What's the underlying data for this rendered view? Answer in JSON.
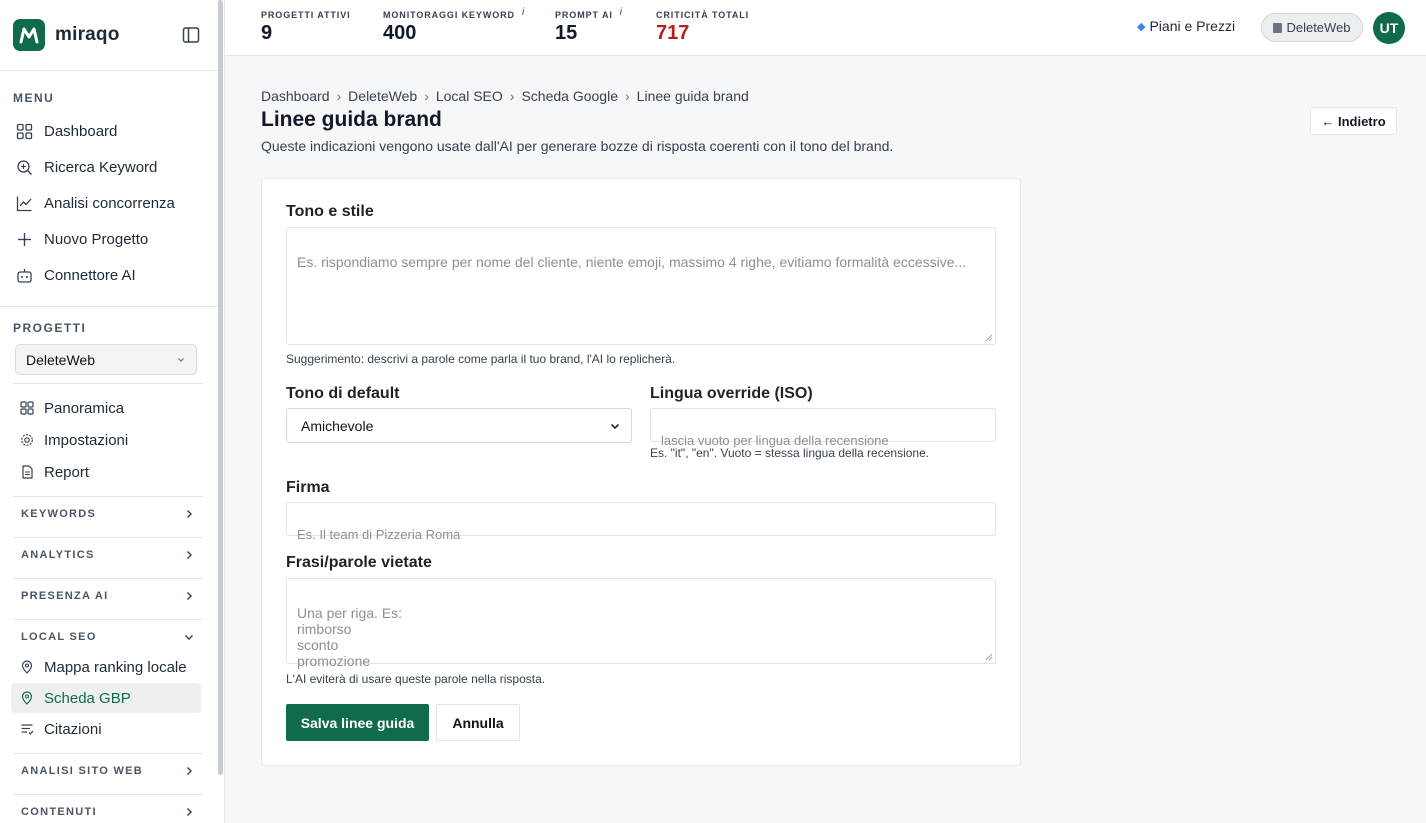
{
  "sidebar": {
    "brand": "miraqo",
    "menu_title": "MENU",
    "menu": [
      {
        "label": "Dashboard",
        "icon": "grid-icon"
      },
      {
        "label": "Ricerca Keyword",
        "icon": "search-icon"
      },
      {
        "label": "Analisi concorrenza",
        "icon": "chart-line-icon"
      },
      {
        "label": "Nuovo Progetto",
        "icon": "plus-icon"
      },
      {
        "label": "Connettore AI",
        "icon": "robot-icon"
      }
    ],
    "projects_title": "PROGETTI",
    "project_selected": "DeleteWeb",
    "project_nav": [
      {
        "label": "Panoramica",
        "icon": "grid-icon"
      },
      {
        "label": "Impostazioni",
        "icon": "gear-icon"
      },
      {
        "label": "Report",
        "icon": "document-icon"
      }
    ],
    "groups": {
      "keywords": "KEYWORDS",
      "analytics": "ANALYTICS",
      "presenza_ai": "PRESENZA AI",
      "local_seo": "LOCAL SEO",
      "analisi_sito": "ANALISI SITO WEB",
      "contenuti": "CONTENUTI"
    },
    "local_seo_items": [
      {
        "label": "Mappa ranking locale",
        "icon": "map-pin-icon"
      },
      {
        "label": "Scheda GBP",
        "icon": "map-pin-icon",
        "active": true
      },
      {
        "label": "Citazioni",
        "icon": "list-icon"
      }
    ]
  },
  "topbar": {
    "stats": [
      {
        "label": "PROGETTI ATTIVI",
        "value": "9",
        "info": false
      },
      {
        "label": "MONITORAGGI KEYWORD",
        "value": "400",
        "info": true
      },
      {
        "label": "PROMPT AI",
        "value": "15",
        "info": true
      },
      {
        "label": "CRITICITÀ TOTALI",
        "value": "717",
        "info": false,
        "color": "#b91c1c"
      }
    ],
    "info_mark": "i",
    "plans_label": "Piani e Prezzi",
    "project_pill": "DeleteWeb",
    "avatar_initials": "UT"
  },
  "breadcrumb": [
    "Dashboard",
    "DeleteWeb",
    "Local SEO",
    "Scheda Google",
    "Linee guida brand"
  ],
  "breadcrumb_sep": "›",
  "page": {
    "title": "Linee guida brand",
    "subtitle": "Queste indicazioni vengono usate dall'AI per generare bozze di risposta coerenti con il tono del brand.",
    "back_label": "← Indietro"
  },
  "form": {
    "tone_style_label": "Tono e stile",
    "tone_style_placeholder": "Es. rispondiamo sempre per nome del cliente, niente emoji, massimo 4 righe, evitiamo formalità eccessive...",
    "tone_style_hint": "Suggerimento: descrivi a parole come parla il tuo brand, l'AI lo replicherà.",
    "default_tone_label": "Tono di default",
    "default_tone_value": "Amichevole",
    "lang_label": "Lingua override (ISO)",
    "lang_placeholder": "lascia vuoto per lingua della recensione",
    "lang_hint": "Es. \"it\", \"en\". Vuoto = stessa lingua della recensione.",
    "signature_label": "Firma",
    "signature_placeholder": "Es. Il team di Pizzeria Roma",
    "banned_label": "Frasi/parole vietate",
    "banned_placeholder": "Una per riga. Es:\nrimborso\nsconto\npromozione",
    "banned_hint": "L'AI eviterà di usare queste parole nella risposta.",
    "save_label": "Salva linee guida",
    "cancel_label": "Annulla"
  },
  "colors": {
    "brand": "#0f6b4b",
    "danger": "#b91c1c"
  }
}
